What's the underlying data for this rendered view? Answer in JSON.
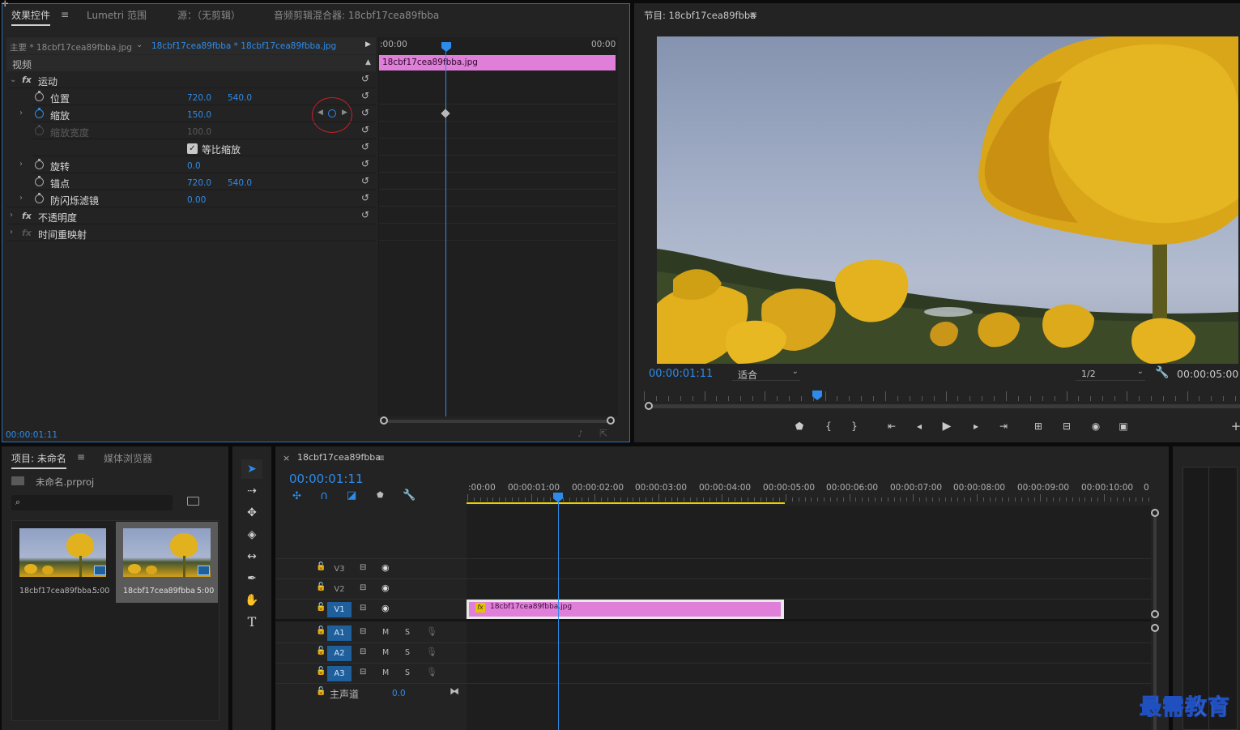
{
  "effect_controls": {
    "tabs": [
      "效果控件",
      "Lumetri 范围",
      "源：（无剪辑）",
      "音频剪辑混合器: 18cbf17cea89fbba"
    ],
    "menu_glyph": "≡",
    "master_clip": "主要 * 18cbf17cea89fbba.jpg",
    "sequence_clip": "18cbf17cea89fbba * 18cbf17cea89fbba.jpg",
    "section_video": "视频",
    "motion": "运动",
    "position_label": "位置",
    "position_x": "720.0",
    "position_y": "540.0",
    "scale_label": "缩放",
    "scale_value": "150.0",
    "scale_width_label": "缩放宽度",
    "scale_width_value": "100.0",
    "uniform_scale_label": "等比缩放",
    "rotation_label": "旋转",
    "rotation_value": "0.0",
    "anchor_label": "锚点",
    "anchor_x": "720.0",
    "anchor_y": "540.0",
    "antiflicker_label": "防闪烁滤镜",
    "antiflicker_value": "0.00",
    "opacity_label": "不透明度",
    "time_remap_label": "时间重映射",
    "fx_glyph": "fx",
    "timeline_start": ":00:00",
    "timeline_end": "00:00",
    "clip_name": "18cbf17cea89fbba.jpg",
    "current_time": "00:00:01:11"
  },
  "program_monitor": {
    "title": "节目: 18cbf17cea89fbba",
    "menu_glyph": "≡",
    "current_time": "00:00:01:11",
    "fit_label": "适合",
    "resolution": "1/2",
    "duration": "00:00:05:00"
  },
  "project": {
    "tabs": [
      "项目: 未命名",
      "媒体浏览器"
    ],
    "menu_glyph": "≡",
    "project_file": "未命名.prproj",
    "search_placeholder": "",
    "items": [
      {
        "name": "18cbf17cea89fbba...",
        "duration": "5:00"
      },
      {
        "name": "18cbf17cea89fbba",
        "duration": "5:00"
      }
    ]
  },
  "timeline": {
    "close_glyph": "×",
    "sequence_name": "18cbf17cea89fbba",
    "menu_glyph": "≡",
    "current_time": "00:00:01:11",
    "ruler": [
      ":00:00",
      "00:00:01:00",
      "00:00:02:00",
      "00:00:03:00",
      "00:00:04:00",
      "00:00:05:00",
      "00:00:06:00",
      "00:00:07:00",
      "00:00:08:00",
      "00:00:09:00",
      "00:00:10:00",
      "0"
    ],
    "video_tracks": [
      "V3",
      "V2",
      "V1"
    ],
    "audio_tracks": [
      "A1",
      "A2",
      "A3"
    ],
    "mute_label": "M",
    "solo_label": "S",
    "master_label": "主声道",
    "master_value": "0.0",
    "clip_name": "18cbf17cea89fbba.jpg",
    "clip_fx": "fx"
  },
  "watermark": "最需教育",
  "colors": {
    "accent_blue": "#2d8ceb",
    "clip_pink": "#e07fd9",
    "panel": "#232323",
    "work_area": "#e6d200"
  }
}
